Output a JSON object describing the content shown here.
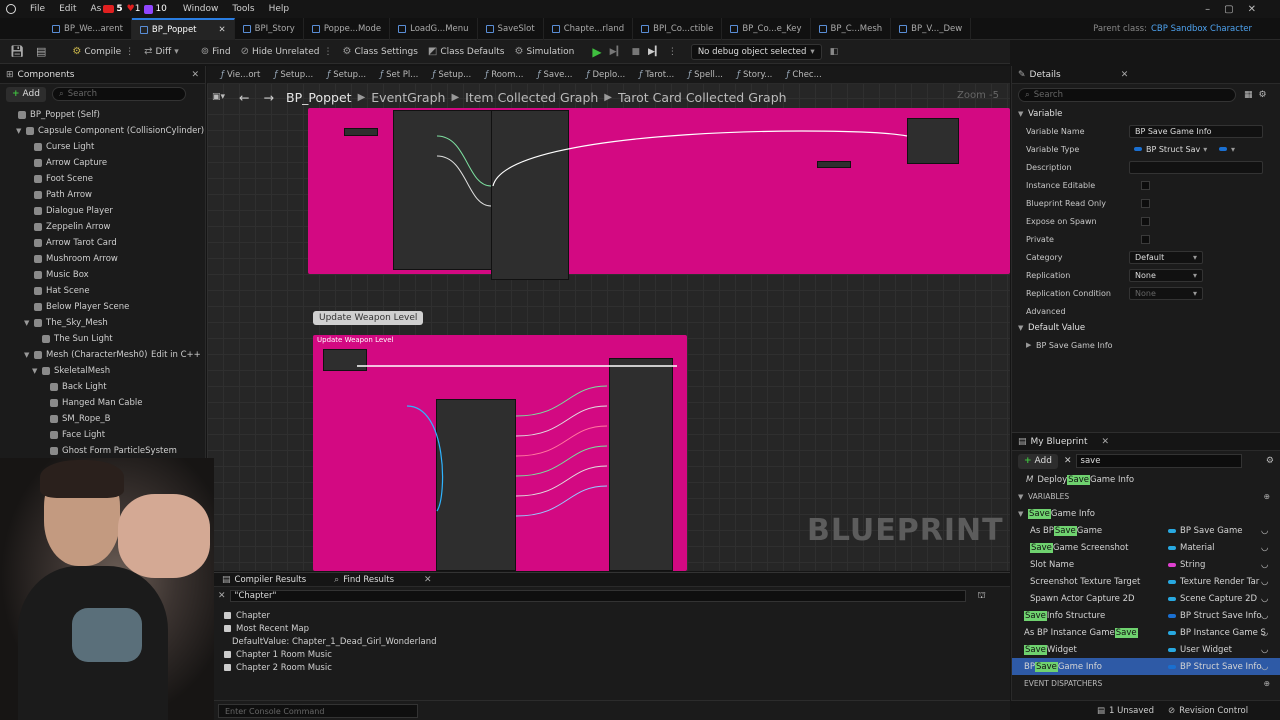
{
  "menu": [
    "File",
    "Edit",
    "As",
    "5",
    "1",
    "10",
    "Window",
    "Tools",
    "Help"
  ],
  "doc_tabs": [
    {
      "label": "BP_We...arent",
      "active": false
    },
    {
      "label": "BP_Poppet",
      "active": true
    },
    {
      "label": "BPI_Story",
      "active": false
    },
    {
      "label": "Poppe...Mode",
      "active": false
    },
    {
      "label": "LoadG...Menu",
      "active": false
    },
    {
      "label": "SaveSlot",
      "active": false
    },
    {
      "label": "Chapte...rland",
      "active": false
    },
    {
      "label": "BPI_Co...ctible",
      "active": false
    },
    {
      "label": "BP_Co...e_Key",
      "active": false
    },
    {
      "label": "BP_C...Mesh",
      "active": false
    },
    {
      "label": "BP_V..._Dew",
      "active": false
    }
  ],
  "parent_class_label": "Parent class:",
  "parent_class_value": "CBP Sandbox Character",
  "toolbar": {
    "compile": "Compile",
    "diff": "Diff",
    "find": "Find",
    "hide_unrelated": "Hide Unrelated",
    "class_settings": "Class Settings",
    "class_defaults": "Class Defaults",
    "simulation": "Simulation",
    "debug_object": "No debug object selected"
  },
  "components": {
    "title": "Components",
    "add": "Add",
    "search_placeholder": "Search",
    "items": [
      {
        "label": "BP_Poppet (Self)",
        "indent": 0,
        "arrow": ""
      },
      {
        "label": "Capsule Component (CollisionCylinder)",
        "indent": 1,
        "arrow": "▼"
      },
      {
        "label": "Curse Light",
        "indent": 2,
        "arrow": ""
      },
      {
        "label": "Arrow Capture",
        "indent": 2,
        "arrow": ""
      },
      {
        "label": "Foot Scene",
        "indent": 2,
        "arrow": ""
      },
      {
        "label": "Path Arrow",
        "indent": 2,
        "arrow": ""
      },
      {
        "label": "Dialogue Player",
        "indent": 2,
        "arrow": ""
      },
      {
        "label": "Zeppelin Arrow",
        "indent": 2,
        "arrow": ""
      },
      {
        "label": "Arrow Tarot Card",
        "indent": 2,
        "arrow": ""
      },
      {
        "label": "Mushroom Arrow",
        "indent": 2,
        "arrow": ""
      },
      {
        "label": "Music Box",
        "indent": 2,
        "arrow": ""
      },
      {
        "label": "Hat Scene",
        "indent": 2,
        "arrow": ""
      },
      {
        "label": "Below Player Scene",
        "indent": 2,
        "arrow": ""
      },
      {
        "label": "The_Sky_Mesh",
        "indent": 2,
        "arrow": "▼"
      },
      {
        "label": "The Sun Light",
        "indent": 3,
        "arrow": ""
      },
      {
        "label": "Mesh (CharacterMesh0)",
        "indent": 2,
        "arrow": "▼"
      },
      {
        "label": "SkeletalMesh",
        "indent": 3,
        "arrow": "▼"
      },
      {
        "label": "Back Light",
        "indent": 4,
        "arrow": ""
      },
      {
        "label": "Hanged Man Cable",
        "indent": 4,
        "arrow": ""
      },
      {
        "label": "SM_Rope_B",
        "indent": 4,
        "arrow": ""
      },
      {
        "label": "Face Light",
        "indent": 4,
        "arrow": ""
      },
      {
        "label": "Ghost Form ParticleSystem",
        "indent": 4,
        "arrow": ""
      }
    ],
    "edit_in_cpp": "Edit in C++"
  },
  "graph_tabs": [
    "Vie...ort",
    "Setup...",
    "Setup...",
    "Set Pl...",
    "Setup...",
    "Room...",
    "Save...",
    "Deplo...",
    "Tarot...",
    "Spell...",
    "Story...",
    "Chec..."
  ],
  "breadcrumb": [
    "BP_Poppet",
    "EventGraph",
    "Item Collected Graph",
    "Tarot Card Collected Graph"
  ],
  "zoom": "Zoom -5",
  "comment_label": "Update Weapon Level",
  "node_title": "Update Weapon Level",
  "watermark": "BLUEPRINT",
  "bottom": {
    "tabs": [
      "Compiler Results",
      "Find Results"
    ],
    "search_value": "\"Chapter\"",
    "results": [
      {
        "label": "Chapter",
        "bullet": true,
        "indent": 0
      },
      {
        "label": "Most Recent Map",
        "bullet": true,
        "indent": 0
      },
      {
        "label": "DefaultValue: Chapter_1_Dead_Girl_Wonderland",
        "bullet": false,
        "indent": 1
      },
      {
        "label": "Chapter 1 Room Music",
        "bullet": true,
        "indent": 0
      },
      {
        "label": "Chapter 2 Room Music",
        "bullet": true,
        "indent": 0
      }
    ],
    "console_placeholder": "Enter Console Command"
  },
  "details": {
    "title": "Details",
    "search_placeholder": "Search",
    "section_variable": "Variable",
    "props": [
      {
        "name": "Variable Name",
        "kind": "text",
        "value": "BP Save Game Info"
      },
      {
        "name": "Variable Type",
        "kind": "type",
        "value": "BP Struct Sav"
      },
      {
        "name": "Description",
        "kind": "text",
        "value": ""
      },
      {
        "name": "Instance Editable",
        "kind": "check",
        "value": ""
      },
      {
        "name": "Blueprint Read Only",
        "kind": "check",
        "value": ""
      },
      {
        "name": "Expose on Spawn",
        "kind": "check",
        "value": ""
      },
      {
        "name": "Private",
        "kind": "check",
        "value": ""
      },
      {
        "name": "Category",
        "kind": "combo",
        "value": "Default"
      },
      {
        "name": "Replication",
        "kind": "combo",
        "value": "None"
      },
      {
        "name": "Replication Condition",
        "kind": "combo-dim",
        "value": "None"
      }
    ],
    "advanced": "Advanced",
    "section_default": "Default Value",
    "default_item": "BP Save Game Info"
  },
  "my_blueprint": {
    "title": "My Blueprint",
    "add": "Add",
    "search_value": "save",
    "deploy_prefix": "Deploy ",
    "deploy_hl": "Save",
    "deploy_suffix": " Game Info",
    "variables_header": "VARIABLES",
    "category_hl": "Save",
    "category_suffix": " Game Info",
    "vars": [
      {
        "pre": "As BP ",
        "hl": "Save",
        "post": " Game",
        "type": "BP Save Game",
        "color": "#28a8e0",
        "indent": 1,
        "selected": false
      },
      {
        "pre": "",
        "hl": "Save",
        "post": " Game Screenshot",
        "type": "Material",
        "color": "#28a8e0",
        "indent": 1,
        "selected": false
      },
      {
        "pre": "Slot Name",
        "hl": "",
        "post": "",
        "type": "String",
        "color": "#e040d0",
        "indent": 1,
        "selected": false
      },
      {
        "pre": "Screenshot Texture Target",
        "hl": "",
        "post": "",
        "type": "Texture Render Tar",
        "color": "#28a8e0",
        "indent": 1,
        "selected": false
      },
      {
        "pre": "Spawn Actor Capture 2D",
        "hl": "",
        "post": "",
        "type": "Scene Capture 2D",
        "color": "#28a8e0",
        "indent": 1,
        "selected": false
      },
      {
        "pre": "",
        "hl": "Save",
        "post": " Info Structure",
        "type": "BP Struct Save Info",
        "color": "#1a6fd0",
        "indent": 0,
        "selected": false
      },
      {
        "pre": "As BP Instance Game ",
        "hl": "Save",
        "post": "",
        "type": "BP Instance Game S",
        "color": "#28a8e0",
        "indent": 0,
        "selected": false
      },
      {
        "pre": "",
        "hl": "Save",
        "post": " Widget",
        "type": "User Widget",
        "color": "#28a8e0",
        "indent": 0,
        "selected": false
      },
      {
        "pre": "BP ",
        "hl": "Save",
        "post": " Game Info",
        "type": "BP Struct Save Info",
        "color": "#1a6fd0",
        "indent": 0,
        "selected": true
      }
    ],
    "dispatchers": "EVENT DISPATCHERS"
  },
  "status": {
    "unsaved": "1 Unsaved",
    "revision": "Revision Control"
  },
  "colors": {
    "comment": "#e2078a",
    "accent": "#2a7de1",
    "highlight": "#6fd26f",
    "selection": "#2e5aa6"
  }
}
